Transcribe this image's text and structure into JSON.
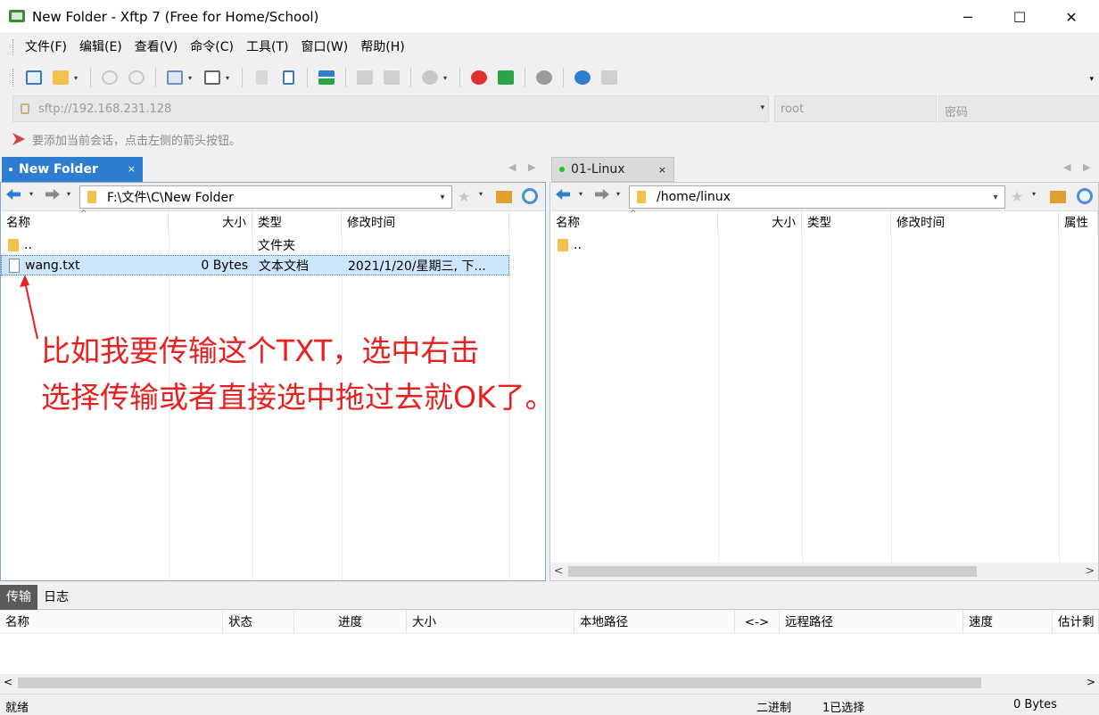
{
  "window": {
    "title": "New Folder - Xftp 7 (Free for Home/School)",
    "minimize": "─",
    "maximize": "☐",
    "close": "✕"
  },
  "menu": [
    "文件(F)",
    "编辑(E)",
    "查看(V)",
    "命令(C)",
    "工具(T)",
    "窗口(W)",
    "帮助(H)"
  ],
  "address": {
    "host_placeholder": "sftp://192.168.231.128",
    "user_placeholder": "root",
    "password_placeholder": "密码"
  },
  "hint": "要添加当前会话，点击左侧的箭头按钮。",
  "colors": {
    "accent": "#2f7dd1",
    "annotation": "#e82020",
    "selection": "#cde6fb",
    "folder": "#f2c14e",
    "session_dot": "#1ec41e"
  },
  "left": {
    "tab_label": "New Folder",
    "path": "F:\\文件\\C\\New Folder",
    "columns": [
      "名称",
      "大小",
      "类型",
      "修改时间"
    ],
    "rows": [
      {
        "name": "..",
        "size": "",
        "type": "文件夹",
        "modified": "",
        "icon": "folder-icon"
      },
      {
        "name": "wang.txt",
        "size": "0 Bytes",
        "type": "文本文档",
        "modified": "2021/1/20/星期三, 下...",
        "icon": "file-icon"
      }
    ]
  },
  "right": {
    "tab_label": "01-Linux",
    "path": "/home/linux",
    "columns": [
      "名称",
      "大小",
      "类型",
      "修改时间",
      "属性"
    ],
    "rows": [
      {
        "name": "..",
        "icon": "folder-icon"
      }
    ]
  },
  "annotation": {
    "line1": "比如我要传输这个TXT，选中右击",
    "line2": "选择传输或者直接选中拖过去就OK了。"
  },
  "transfer": {
    "tabs": [
      "传输",
      "日志"
    ],
    "columns": [
      "名称",
      "状态",
      "进度",
      "大小",
      "本地路径",
      "<->",
      "远程路径",
      "速度",
      "估计剩"
    ]
  },
  "status": {
    "ready": "就绪",
    "mode": "二进制",
    "selected": "1已选择",
    "size": "0 Bytes"
  },
  "glyphs": {
    "close_small": "×",
    "chev_down": "▾",
    "scroll_left": "<",
    "scroll_right": ">",
    "tab_prev": "◀",
    "tab_next": "▶",
    "star": "★"
  }
}
